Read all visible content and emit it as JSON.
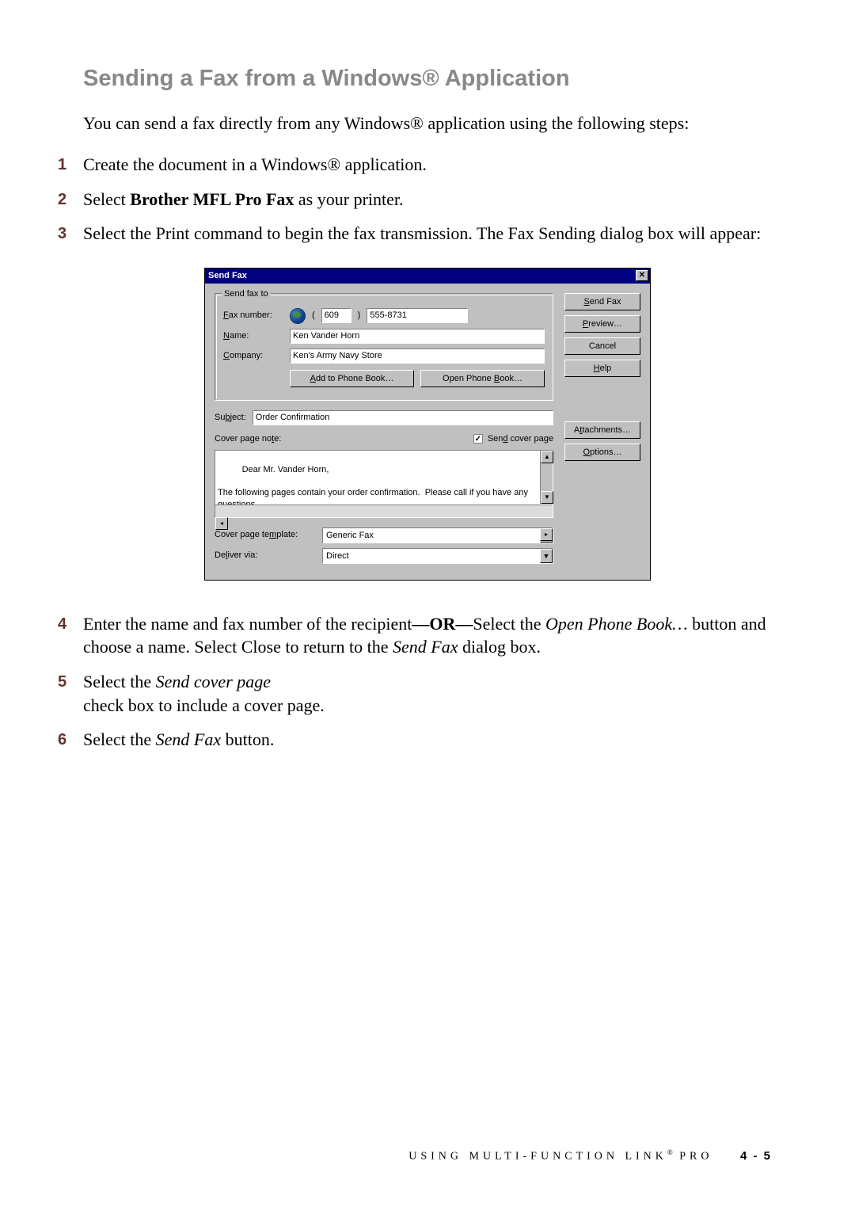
{
  "heading": "Sending a Fax from a Windows® Application",
  "intro": "You can send a fax directly from any Windows® application using the following steps:",
  "steps": {
    "s1": "Create the document in a Windows® application.",
    "s2_pre": "Select ",
    "s2_bold": "Brother MFL Pro Fax",
    "s2_post": " as your printer.",
    "s3": "Select the Print command to begin the fax transmission. The Fax Sending dialog box will appear:",
    "s4_a": "Enter the name and fax number of the recipient",
    "s4_or": "—OR—",
    "s4_b": "Select the ",
    "s4_i1": "Open Phone Book…",
    "s4_c": " button and choose a name.  Select Close to return to the ",
    "s4_i2": "Send Fax",
    "s4_d": " dialog box.",
    "s5_a": "Select the ",
    "s5_i": "Send cover page",
    "s5_b": " check box to include a cover page.",
    "s6_a": "Select the ",
    "s6_i": "Send Fax",
    "s6_b": " button."
  },
  "dlg": {
    "title": "Send Fax",
    "group_legend": "Send fax to",
    "fax_label": "Fax number:",
    "area_code": "609",
    "fax_number": "555-8731",
    "name_label": "Name:",
    "name_value": "Ken Vander Horn",
    "company_label": "Company:",
    "company_value": "Ken's Army Navy Store",
    "btn_add": "Add to Phone Book…",
    "btn_open": "Open Phone Book…",
    "subject_label": "Subject:",
    "subject_value": "Order Confirmation",
    "cover_note_label": "Cover page note:",
    "send_cover_label": "Send cover page",
    "cover_note_text": "Dear Mr. Vander Horn,\n\nThe following pages contain your order confirmation.  Please call if you have any questions.",
    "template_label": "Cover page template:",
    "template_value": "Generic Fax",
    "deliver_label": "Deliver via:",
    "deliver_value": "Direct",
    "btn_send": "Send Fax",
    "btn_preview": "Preview…",
    "btn_cancel": "Cancel",
    "btn_help": "Help",
    "btn_attach": "Attachments…",
    "btn_options": "Options…"
  },
  "footer": {
    "text": "USING MULTI-FUNCTION LINK",
    "suffix": " PRO",
    "page": "4 - 5"
  }
}
